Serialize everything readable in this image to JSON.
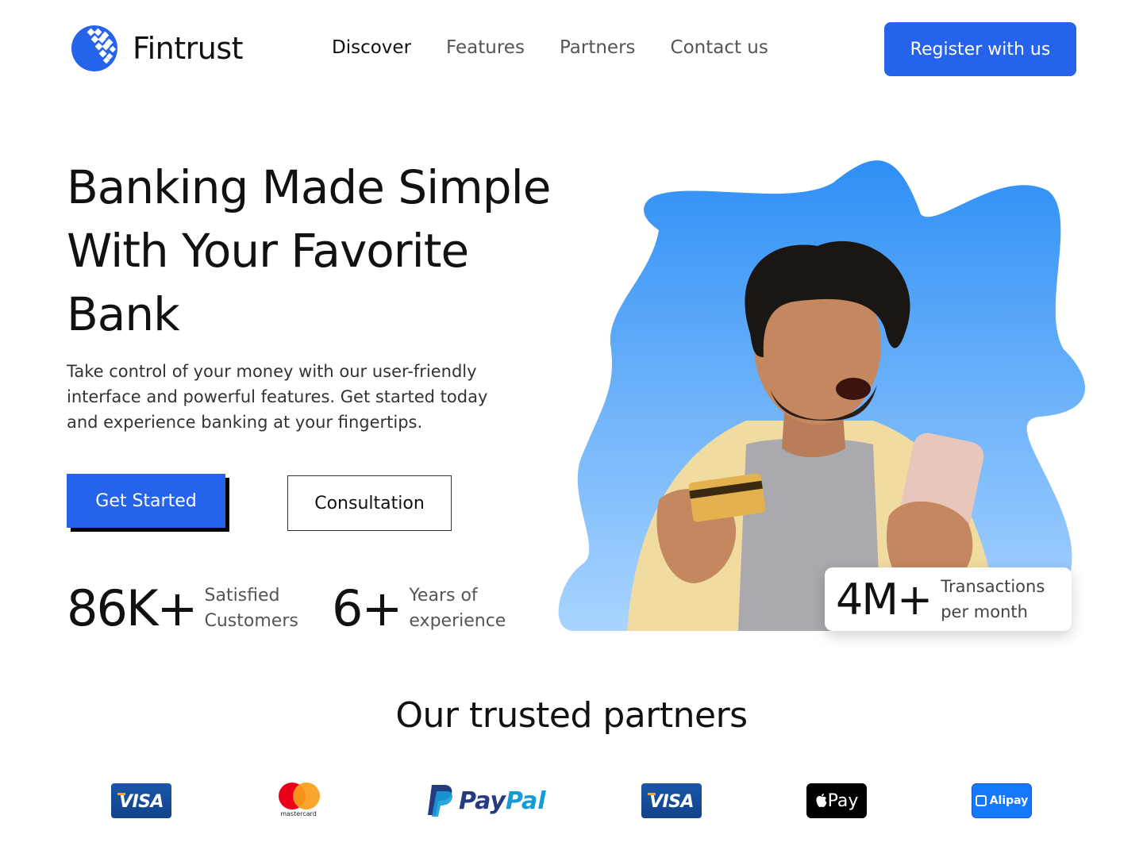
{
  "brand": {
    "name": "Fintrust",
    "color": "#2563eb"
  },
  "nav": {
    "items": [
      {
        "label": "Discover",
        "active": true
      },
      {
        "label": "Features",
        "active": false
      },
      {
        "label": "Partners",
        "active": false
      },
      {
        "label": "Contact us",
        "active": false
      }
    ],
    "register_label": "Register with us"
  },
  "hero": {
    "title": "Banking Made Simple With Your Favorite Bank",
    "subtitle": "Take control of your money with our user-friendly interface and powerful features. Get started today and experience banking at your fingertips.",
    "primary_cta": "Get Started",
    "secondary_cta": "Consultation",
    "stats": [
      {
        "value": "86K+",
        "label": "Satisfied Customers"
      },
      {
        "value": "6+",
        "label": "Years of experience"
      }
    ],
    "highlight": {
      "value": "4M+",
      "label": "Transactions per month"
    }
  },
  "partners": {
    "title": "Our trusted partners",
    "logos": [
      {
        "name": "visa-logo",
        "text": "VISA"
      },
      {
        "name": "mastercard-logo",
        "text": "mastercard"
      },
      {
        "name": "paypal-logo",
        "text_a": "Pay",
        "text_b": "Pal"
      },
      {
        "name": "visa-logo",
        "text": "VISA"
      },
      {
        "name": "apple-pay-logo",
        "text": "Pay"
      },
      {
        "name": "alipay-logo",
        "text": "Alipay"
      }
    ]
  }
}
